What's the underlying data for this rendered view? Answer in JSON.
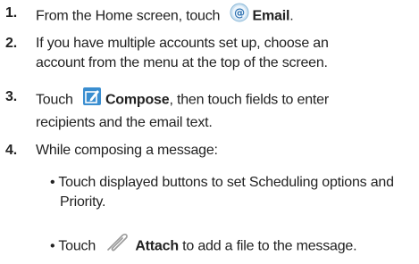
{
  "steps": [
    {
      "number": "1.",
      "pre": "From the Home screen, touch",
      "icon": "email-app-icon",
      "bold": "Email",
      "post": "."
    },
    {
      "number": "2.",
      "line1": "If you have multiple accounts set up, choose an",
      "line2": "account from the menu at the top of the screen."
    },
    {
      "number": "3.",
      "pre": "Touch",
      "icon": "compose-icon",
      "bold": "Compose",
      "post": ", then touch fields to enter",
      "line2": "recipients and the email text."
    },
    {
      "number": "4.",
      "text": "While composing a message:"
    }
  ],
  "bullets": [
    {
      "line1": "• Touch displayed buttons to set Scheduling options and",
      "line2": "Priority."
    },
    {
      "pre": "• Touch",
      "icon": "paperclip-icon",
      "bold": "Attach",
      "post": " to add a file to the message."
    }
  ],
  "colors": {
    "text": "#222222",
    "compose_icon": "#3a8ed0",
    "email_icon_ring": "#8ab8d8",
    "paperclip": "#9a9a9a"
  }
}
